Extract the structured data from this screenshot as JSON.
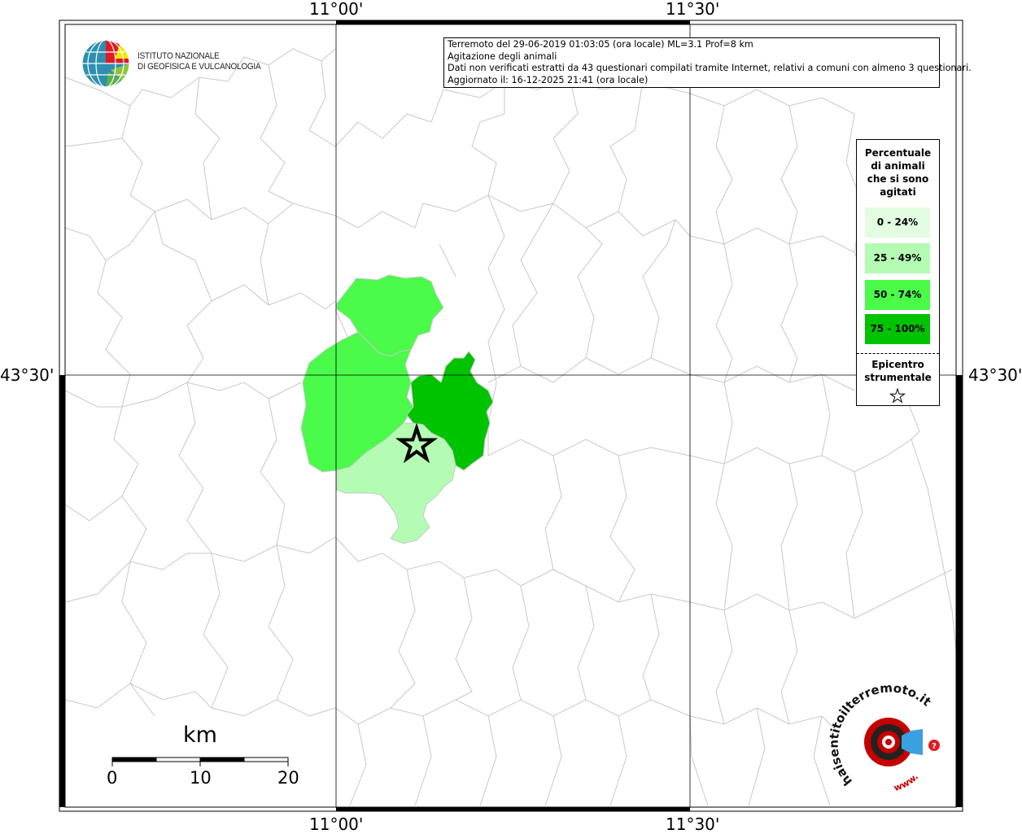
{
  "map": {
    "top_longitudes": [
      "11°00'",
      "11°30'"
    ],
    "bottom_longitudes": [
      "11°00'",
      "11°30'"
    ],
    "left_latitude": "43°30'",
    "right_latitude": "43°30'"
  },
  "info": {
    "line1": "Terremoto del 29-06-2019 01:03:05 (ora locale) ML=3.1 Prof=8 km",
    "line2": "Agitazione degli animali",
    "line3": "Dati non verificati estratti da 43 questionari compilati tramite Internet, relativi a comuni con almeno 3 questionari.",
    "line4": "Aggiornato il: 16-12-2025 21:41 (ora locale)"
  },
  "legend": {
    "title_lines": [
      "Percentuale",
      "di animali",
      "che si sono",
      "agitati"
    ],
    "classes": [
      {
        "label": "0 - 24%",
        "color": "#e3fde3"
      },
      {
        "label": "25 - 49%",
        "color": "#b4fcb4"
      },
      {
        "label": "50 - 74%",
        "color": "#4afb4a"
      },
      {
        "label": "75 - 100%",
        "color": "#00c300"
      }
    ],
    "epicenter_lines": [
      "Epicentro",
      "strumentale"
    ]
  },
  "logos": {
    "ingv_line1": "ISTITUTO NAZIONALE",
    "ingv_line2": "DI GEOFISICA E VULCANOLOGIA",
    "hsit_text": "haisentitoilterremoto.it",
    "hsit_www": "www."
  },
  "scale": {
    "title": "km",
    "labels": [
      "0",
      "10",
      "20"
    ]
  }
}
